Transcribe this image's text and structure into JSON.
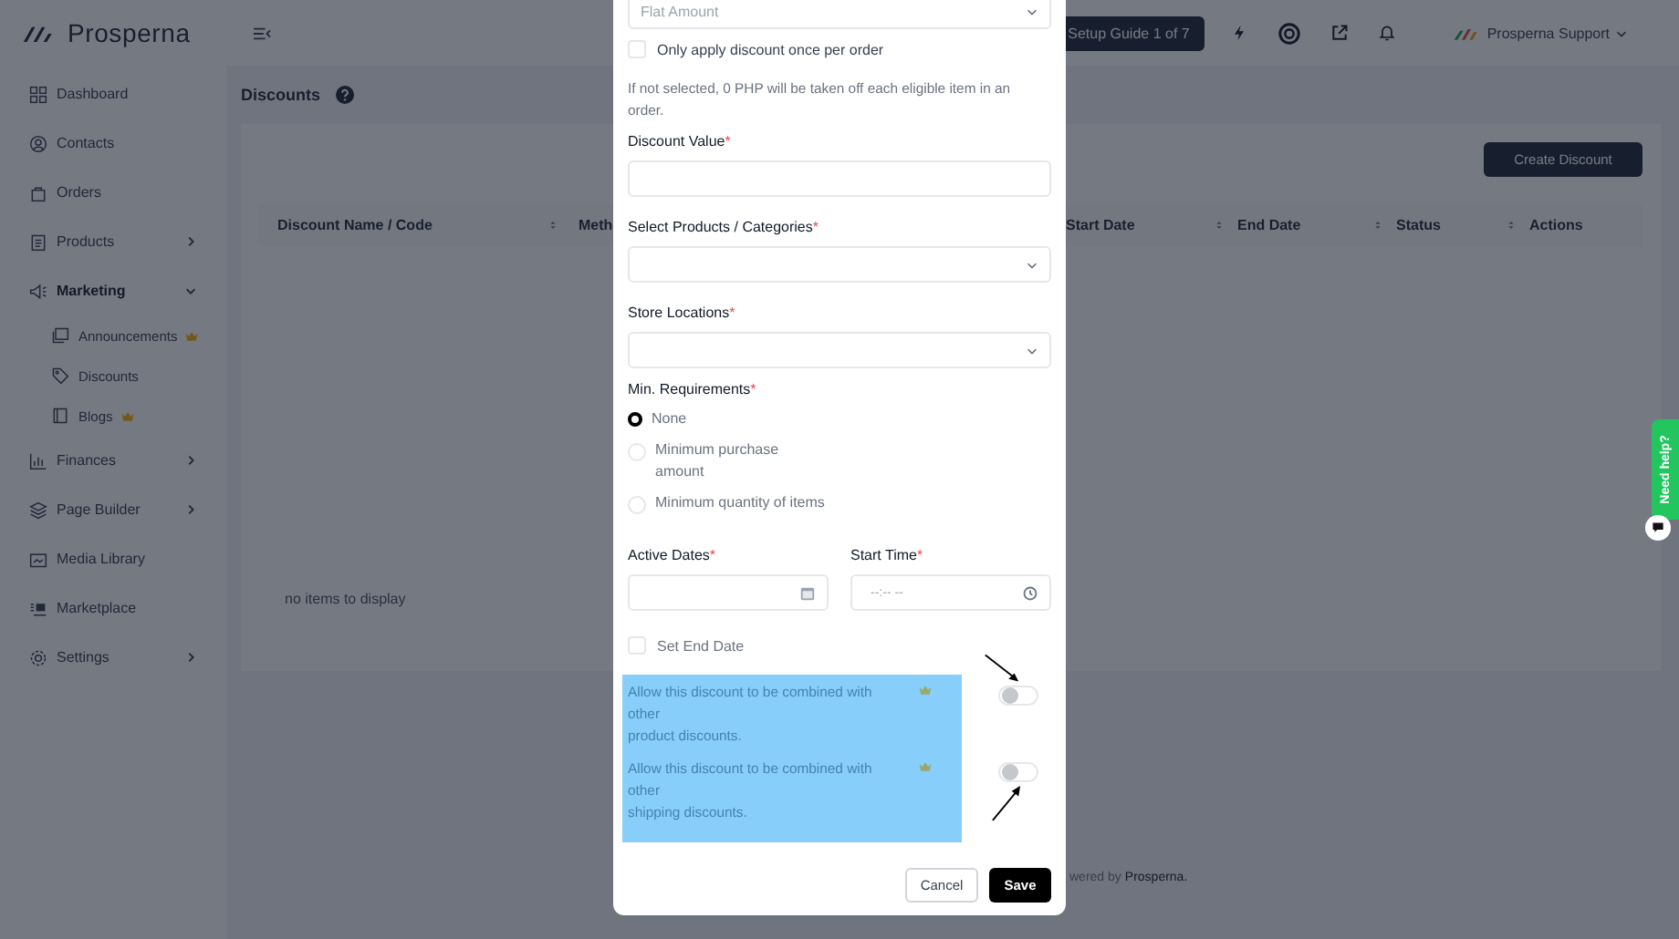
{
  "topbar": {
    "brand": "Prosperna",
    "setup_guide": "Setup Guide 1 of 7",
    "account": "Prosperna Support"
  },
  "sidebar": {
    "items": [
      {
        "label": "Dashboard"
      },
      {
        "label": "Contacts"
      },
      {
        "label": "Orders"
      },
      {
        "label": "Products",
        "expandable": true,
        "expanded": false
      },
      {
        "label": "Marketing",
        "expandable": true,
        "expanded": true,
        "children": [
          {
            "label": "Announcements",
            "premium": true
          },
          {
            "label": "Discounts",
            "premium": false
          },
          {
            "label": "Blogs",
            "premium": true
          }
        ]
      },
      {
        "label": "Finances",
        "expandable": true,
        "expanded": false
      },
      {
        "label": "Page Builder",
        "expandable": true,
        "expanded": false
      },
      {
        "label": "Media Library"
      },
      {
        "label": "Marketplace"
      },
      {
        "label": "Settings",
        "expandable": true,
        "expanded": false
      }
    ]
  },
  "page": {
    "title": "Discounts",
    "create_button": "Create Discount",
    "table": {
      "columns": [
        {
          "label": "Discount Name / Code",
          "sortable": true
        },
        {
          "label": "Meth",
          "sortable": false
        },
        {
          "label": "Start Date",
          "sortable": true
        },
        {
          "label": "End Date",
          "sortable": true
        },
        {
          "label": "Status",
          "sortable": true
        },
        {
          "label": "Actions",
          "sortable": false
        }
      ],
      "empty_text": "no items to display"
    },
    "footer": {
      "text": "wered by",
      "link": "Prosperna."
    }
  },
  "modal": {
    "type_select": {
      "value": "Flat Amount"
    },
    "once_per_order": {
      "label": "Only apply discount once per order",
      "checked": false
    },
    "help_text": "If not selected, 0 PHP will be taken off each eligible item in an order.",
    "discount_value": {
      "label": "Discount Value",
      "required_mark": "*"
    },
    "products": {
      "label": "Select Products / Categories",
      "required_mark": "*"
    },
    "locations": {
      "label": "Store Locations",
      "required_mark": "*"
    },
    "min_requirements": {
      "label": "Min. Requirements",
      "required_mark": "*",
      "options": [
        {
          "label": "None",
          "selected": true
        },
        {
          "label": "Minimum purchase amount",
          "selected": false
        },
        {
          "label": "Minimum quantity of items",
          "selected": false
        }
      ]
    },
    "active_dates": {
      "label": "Active Dates",
      "required_mark": "*"
    },
    "start_time": {
      "label": "Start Time",
      "required_mark": "*",
      "placeholder": "--:-- --"
    },
    "set_end_date": {
      "label": "Set End Date",
      "checked": false
    },
    "combine_options": [
      {
        "lines": [
          "Allow this discount to be combined with other",
          "product discounts."
        ],
        "premium": true,
        "on": false
      },
      {
        "lines": [
          "Allow this discount to be combined with other",
          "shipping discounts."
        ],
        "premium": true,
        "on": false
      }
    ],
    "buttons": {
      "cancel": "Cancel",
      "save": "Save"
    }
  },
  "help_tab": {
    "label": "Need help?"
  }
}
